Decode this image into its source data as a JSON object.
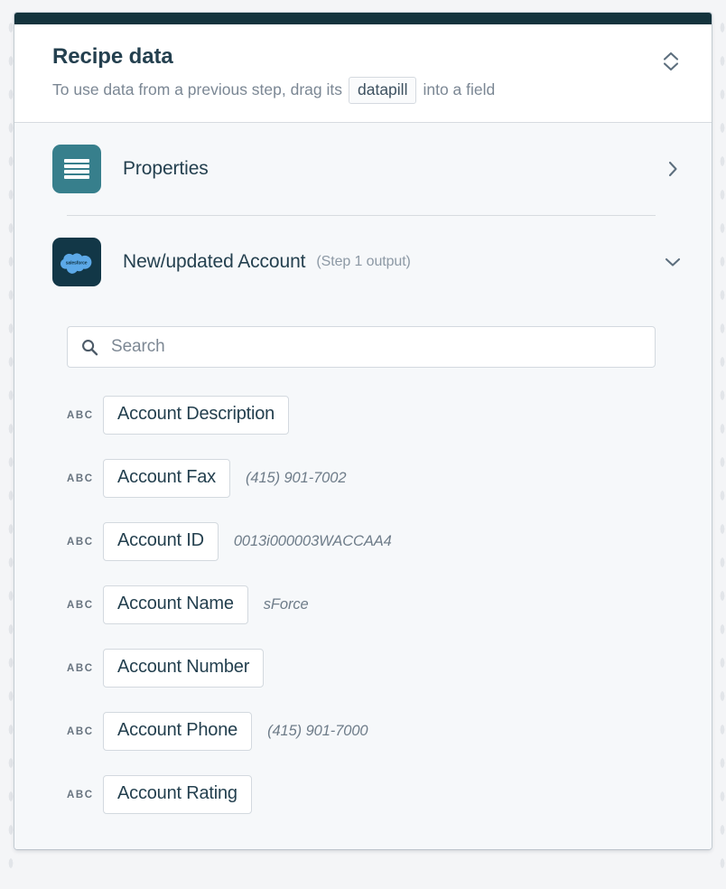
{
  "header": {
    "title": "Recipe data",
    "subtitle_before": "To use data from a previous step, drag its",
    "datapill_label": "datapill",
    "subtitle_after": "into a field",
    "collapse_icon": "chevron-up-down-icon"
  },
  "colors": {
    "topbar": "#14333d",
    "properties_tile": "#377f8c",
    "salesforce_tile": "#123747",
    "salesforce_cloud": "#5ca9e8",
    "panel_body": "#f6f8fa",
    "title_text": "#24404f",
    "muted_text": "#7b8794"
  },
  "sections": [
    {
      "name": "properties",
      "label": "Properties",
      "sublabel": "",
      "icon": "list-lines-icon",
      "chevron": "chevron-right-icon",
      "expanded": false
    },
    {
      "name": "new-updated-account",
      "label": "New/updated Account",
      "sublabel": "(Step 1 output)",
      "icon": "salesforce-cloud-icon",
      "chevron": "chevron-down-icon",
      "expanded": true
    }
  ],
  "search": {
    "placeholder": "Search",
    "value": "",
    "icon": "search-icon"
  },
  "fields": [
    {
      "type": "ABC",
      "label": "Account Description",
      "sample": ""
    },
    {
      "type": "ABC",
      "label": "Account Fax",
      "sample": "(415) 901-7002"
    },
    {
      "type": "ABC",
      "label": "Account ID",
      "sample": "0013i000003WACCAA4"
    },
    {
      "type": "ABC",
      "label": "Account Name",
      "sample": "sForce"
    },
    {
      "type": "ABC",
      "label": "Account Number",
      "sample": ""
    },
    {
      "type": "ABC",
      "label": "Account Phone",
      "sample": "(415) 901-7000"
    },
    {
      "type": "ABC",
      "label": "Account Rating",
      "sample": ""
    }
  ]
}
